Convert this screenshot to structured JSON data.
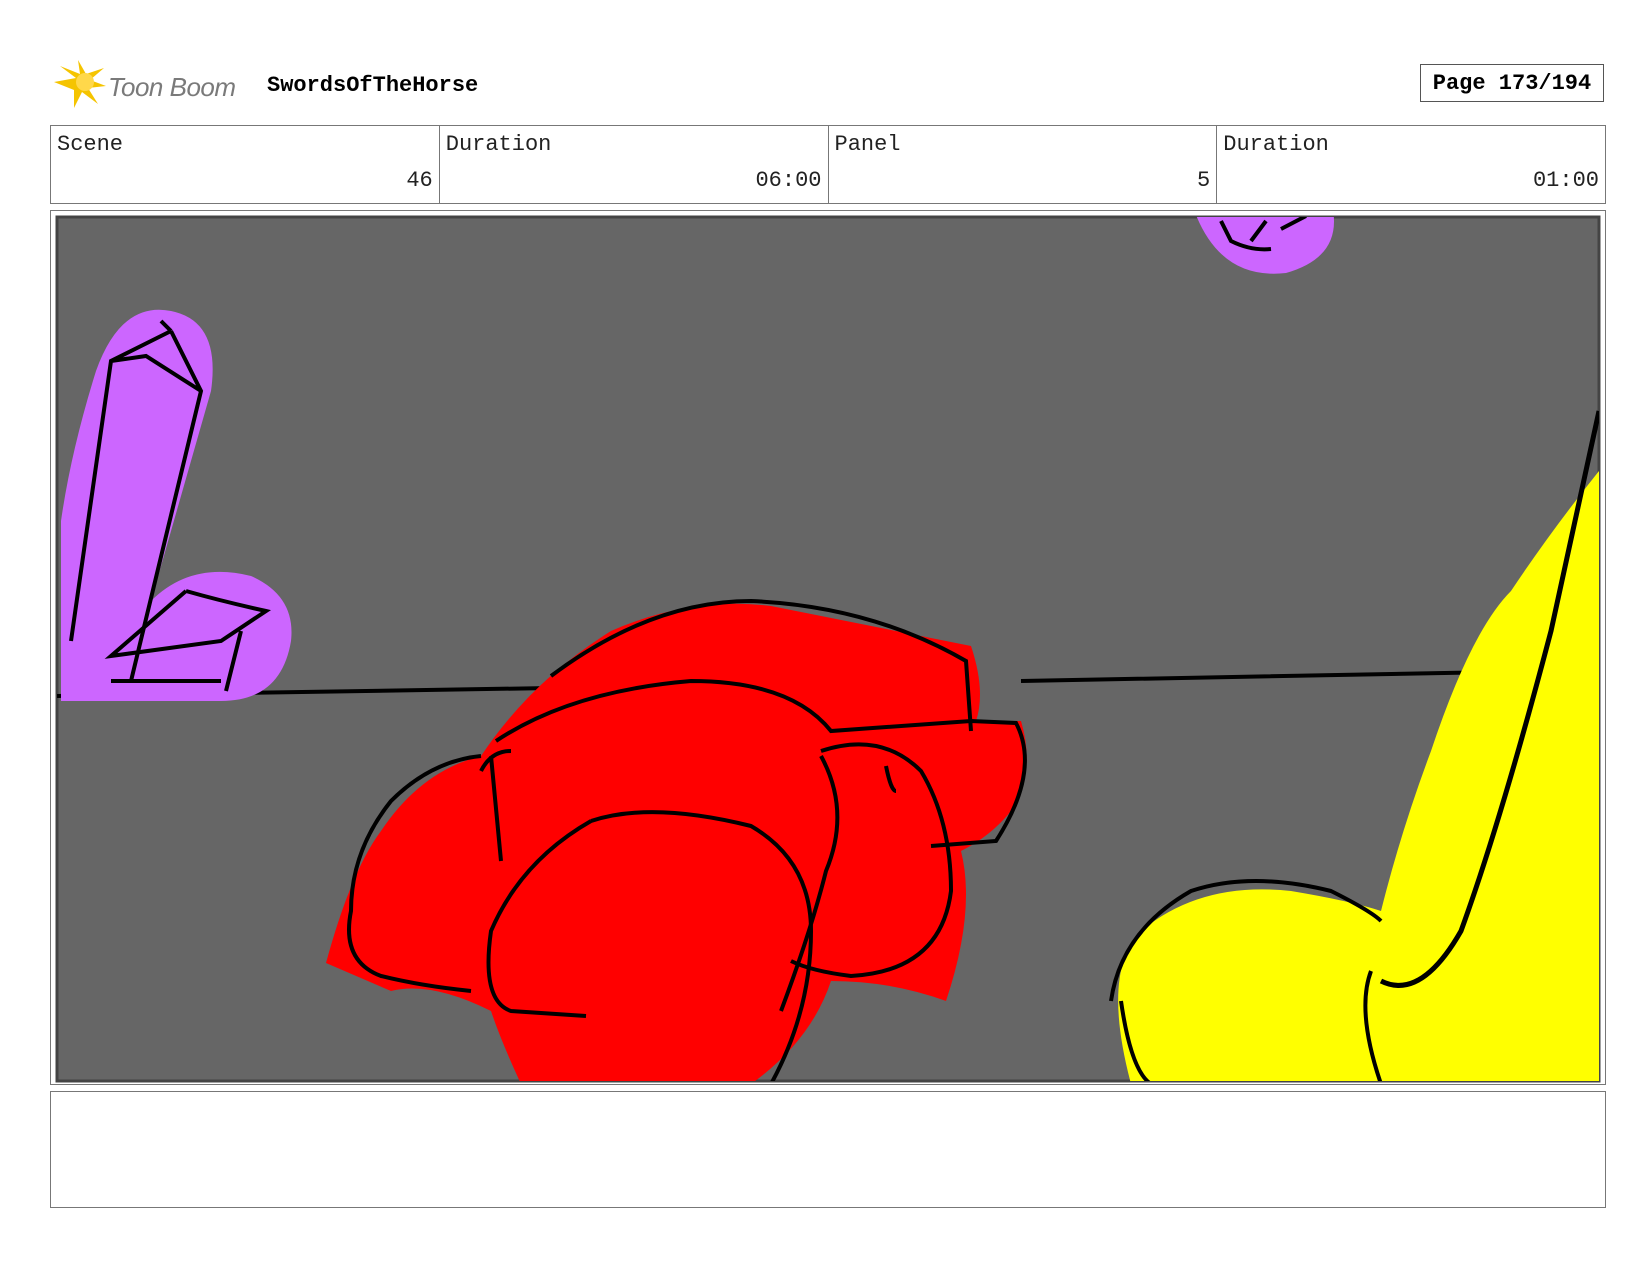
{
  "header": {
    "logo_text": "Toon Boom",
    "project_name": "SwordsOfTheHorse",
    "page_label": "Page 173/194"
  },
  "info": {
    "scene_label": "Scene",
    "scene_value": "46",
    "scene_duration_label": "Duration",
    "scene_duration_value": "06:00",
    "panel_label": "Panel",
    "panel_value": "5",
    "panel_duration_label": "Duration",
    "panel_duration_value": "01:00"
  },
  "colors": {
    "background_gray": "#666666",
    "red": "#ff0000",
    "purple": "#cc66ff",
    "yellow": "#ffff00",
    "logo_yellow": "#f5c400"
  },
  "notes": {
    "text": ""
  }
}
